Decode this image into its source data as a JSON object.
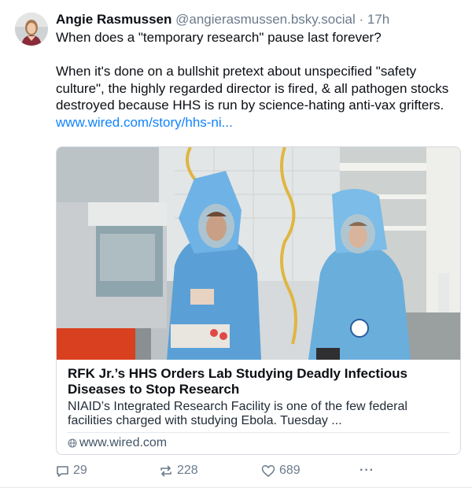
{
  "post": {
    "author_name": "Angie Rasmussen",
    "handle": "@angierasmussen.bsky.social",
    "separator": "·",
    "time": "17h",
    "text_line1": "When does a \"temporary research\" pause last forever?",
    "text_para2": "When it's done on a bullshit pretext about unspecified \"safety culture\", the highly regarded director is fired, & all pathogen stocks destroyed because HHS is run by science-hating anti-vax grifters.",
    "link_text": "www.wired.com/story/hhs-ni..."
  },
  "card": {
    "title": "RFK Jr.’s HHS Orders Lab Studying Deadly Infectious Diseases to Stop Research",
    "description": "NIAID’s Integrated Research Facility is one of the few federal facilities charged with studying Ebola. Tuesday ...",
    "domain": "www.wired.com"
  },
  "actions": {
    "reply_count": "29",
    "repost_count": "228",
    "like_count": "689",
    "more_label": "···"
  },
  "icons": {
    "reply": "speech-bubble-icon",
    "repost": "repost-arrows-icon",
    "like": "heart-icon",
    "more": "ellipsis-icon",
    "domain": "globe-icon"
  },
  "colors": {
    "link": "#1083fe",
    "muted": "#6b7b8c",
    "text": "#0b0f14",
    "border": "#d4dbe2"
  }
}
